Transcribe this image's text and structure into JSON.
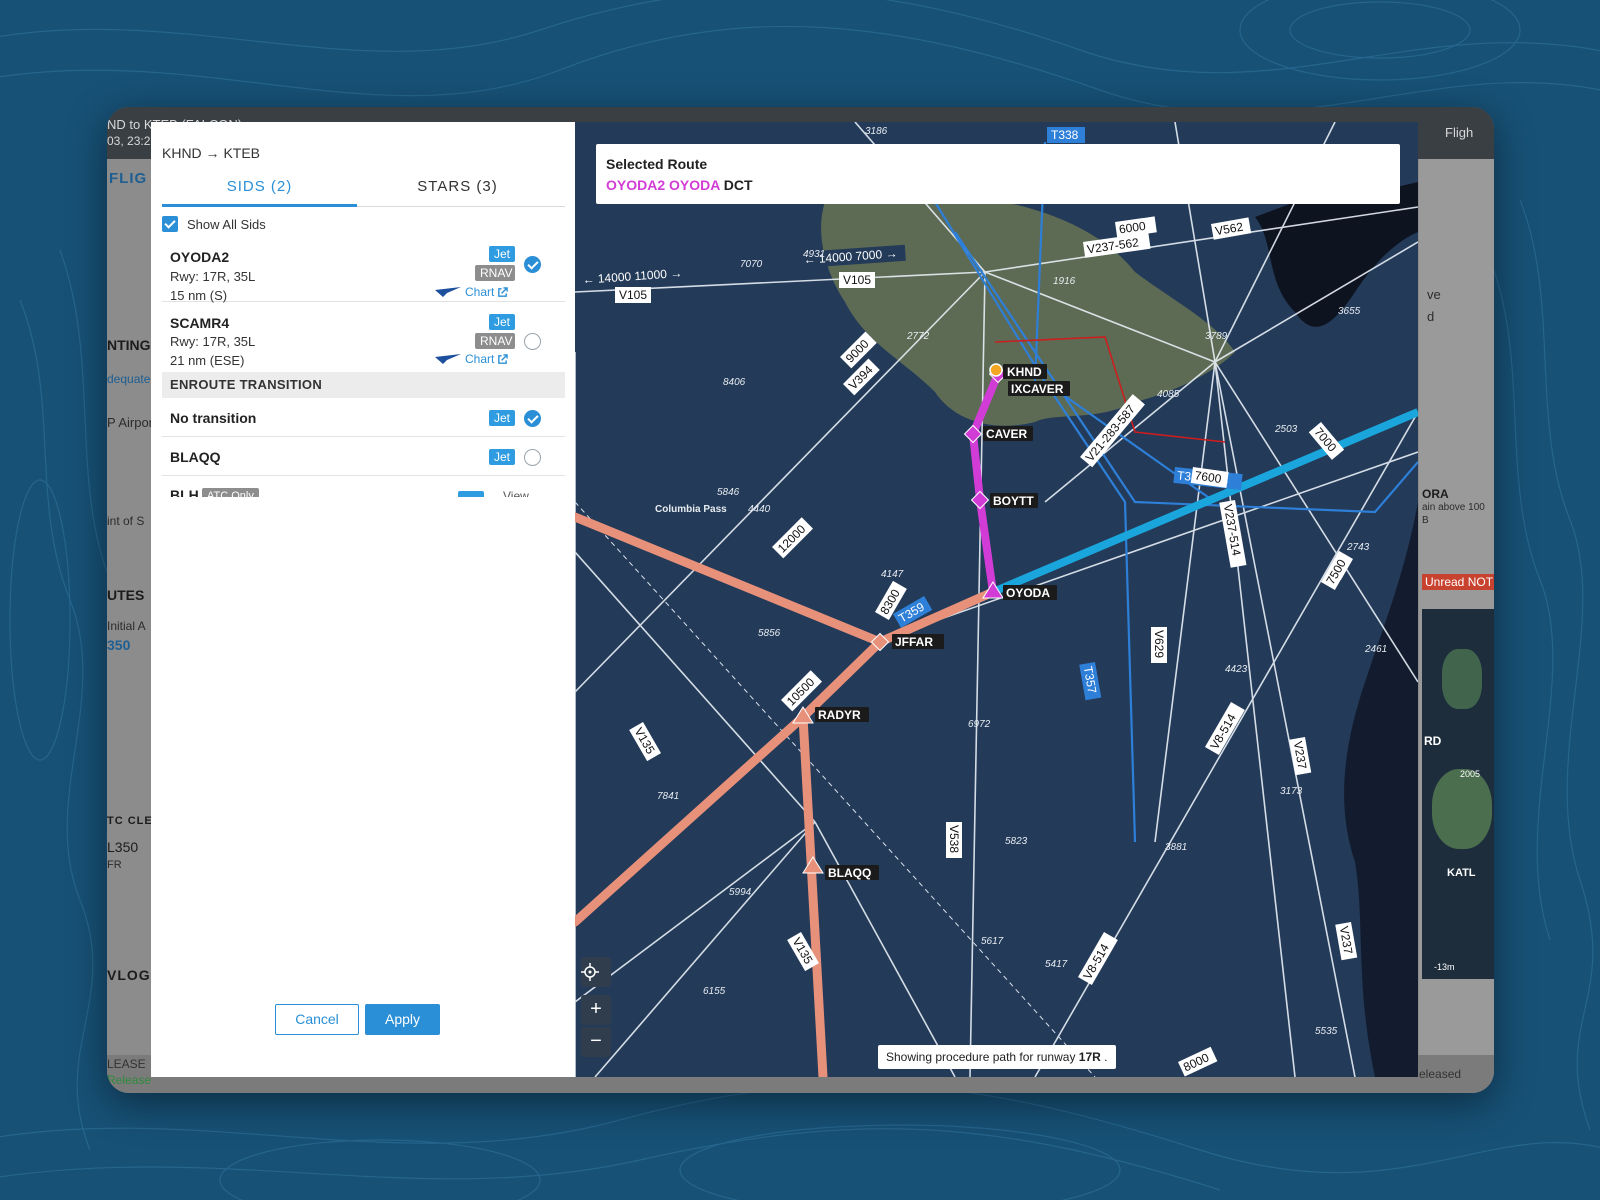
{
  "background_app": {
    "header_route": "ND to KTEB (FALCON)",
    "header_date": "03, 23:2",
    "flight_tab": "FLIG",
    "right_header": "Fligh",
    "section_planning": "NTING",
    "adequate_link": "dequate",
    "airport_text": "P Airpor",
    "point_text": "int of S",
    "routes_heading": "UTES",
    "initial_text": "Initial A",
    "fl_value": "350",
    "atc_clearance": "TC CLE",
    "l350": "L350",
    "fr": "FR",
    "vlog": "VLOG",
    "release": "LEASE",
    "released": "Release",
    "right_ve": "ve",
    "right_d": "d",
    "right_ora": "ORA",
    "right_terrain": "ain above 100",
    "right_b": "B",
    "unread": "Unread NOT",
    "right_rd": "RD",
    "katl": "KATL",
    "right_2005": "2005",
    "right_released": "eleased",
    "minus13m": "-13m"
  },
  "panel": {
    "route_pair": "KHND → KTEB",
    "tabs": [
      {
        "label": "SIDS (2)",
        "active": true
      },
      {
        "label": "STARS (3)",
        "active": false
      }
    ],
    "show_all_label": "Show All Sids",
    "procedures": [
      {
        "name": "OYODA2",
        "runways": "Rwy: 17R, 35L",
        "distance": "15 nm (S)",
        "badge_jet": "Jet",
        "badge_rnav": "RNAV",
        "chart_label": "Chart",
        "selected": true
      },
      {
        "name": "SCAMR4",
        "runways": "Rwy: 17R, 35L",
        "distance": "21 nm (ESE)",
        "badge_jet": "Jet",
        "badge_rnav": "RNAV",
        "chart_label": "Chart",
        "selected": false
      }
    ],
    "enroute_heading": "ENROUTE TRANSITION",
    "transitions": [
      {
        "name": "No transition",
        "badge": "Jet",
        "selected": true
      },
      {
        "name": "BLAQQ",
        "badge": "Jet",
        "selected": false
      },
      {
        "name": "BLH",
        "badge": "ATC Only",
        "extra": "View"
      }
    ],
    "cancel_label": "Cancel",
    "apply_label": "Apply"
  },
  "map": {
    "selected_route_title": "Selected Route",
    "selected_route_procedure": "OYODA2 OYODA",
    "selected_route_suffix": "DCT",
    "footer_prefix": "Showing procedure path for runway",
    "footer_runway": "17R",
    "footer_suffix": ".",
    "zoom_in": "+",
    "zoom_out": "−",
    "waypoints": [
      "KHND",
      "IXCAVER",
      "CAVER",
      "BOYTT",
      "OYODA",
      "JFFAR",
      "RADYR",
      "BLAQQ"
    ],
    "airway_labels": [
      "T338",
      "V105",
      "V237-562",
      "V562",
      "V394",
      "V21-283-587",
      "T361-363",
      "V237-514",
      "V629",
      "T357",
      "V538",
      "V8-514",
      "V237",
      "V135",
      "T359",
      "V8"
    ],
    "altitude_labels": [
      "14000 11000",
      "14000 7000",
      "6000",
      "9000",
      "10500",
      "7600",
      "7000",
      "12000",
      "8300",
      "8000",
      "7500"
    ],
    "elevations": [
      "3186",
      "7070",
      "4931",
      "1916",
      "2772",
      "8406",
      "5846",
      "4440",
      "4147",
      "5856",
      "6972",
      "5823",
      "7841",
      "5994",
      "6155",
      "5617",
      "5417",
      "3655",
      "3789",
      "4085",
      "2503",
      "2743",
      "2461",
      "4423",
      "3173",
      "3881",
      "5535"
    ],
    "place_label": "Columbia Pass",
    "colors": {
      "magenta": "#d23cd6",
      "salmon": "#e8917a",
      "cyan": "#1aa6dc",
      "airway_blue": "#2e7fd8",
      "land": "#5d6b55",
      "water": "#0e1320",
      "map_bg": "#233a58"
    }
  }
}
